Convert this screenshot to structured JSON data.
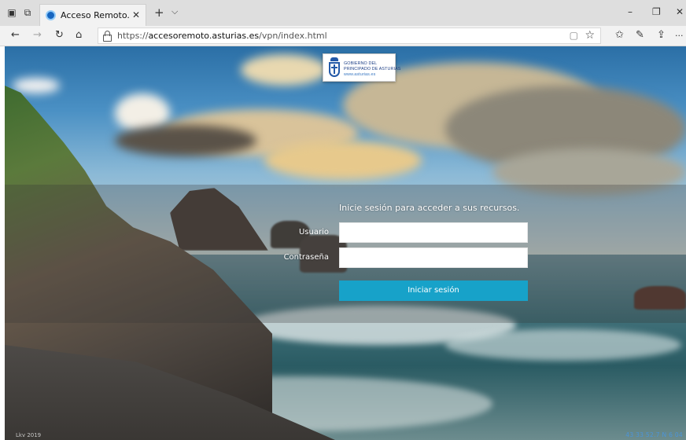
{
  "browser": {
    "tab_title": "Acceso Remoto. Gobier",
    "tab_close": "✕",
    "new_tab": "+",
    "tab_list": "⌵",
    "minimize": "–",
    "restore": "❐",
    "close": "✕",
    "back": "←",
    "forward": "→",
    "refresh": "↻",
    "home": "⌂",
    "url_prefix": "https://",
    "url_host": "accesoremoto.asturias.es",
    "url_path": "/vpn/index.html",
    "reading_view": "▢",
    "favorite": "☆",
    "favorites_hub": "✩",
    "pen": "✎",
    "share": "⇪",
    "more": "···"
  },
  "logo": {
    "line1": "GOBIERNO DEL",
    "line2": "PRINCIPADO DE ASTURIAS",
    "line3": "www.asturias.es"
  },
  "login": {
    "prompt": "Inicie sesión para acceder a sus recursos.",
    "username_label": "Usuario",
    "username_value": "",
    "password_label": "Contraseña",
    "password_value": "",
    "submit_label": "Iniciar sesión"
  },
  "footer": {
    "left": "Lkv 2019",
    "right": "43 33 52.7 N 6 04"
  }
}
